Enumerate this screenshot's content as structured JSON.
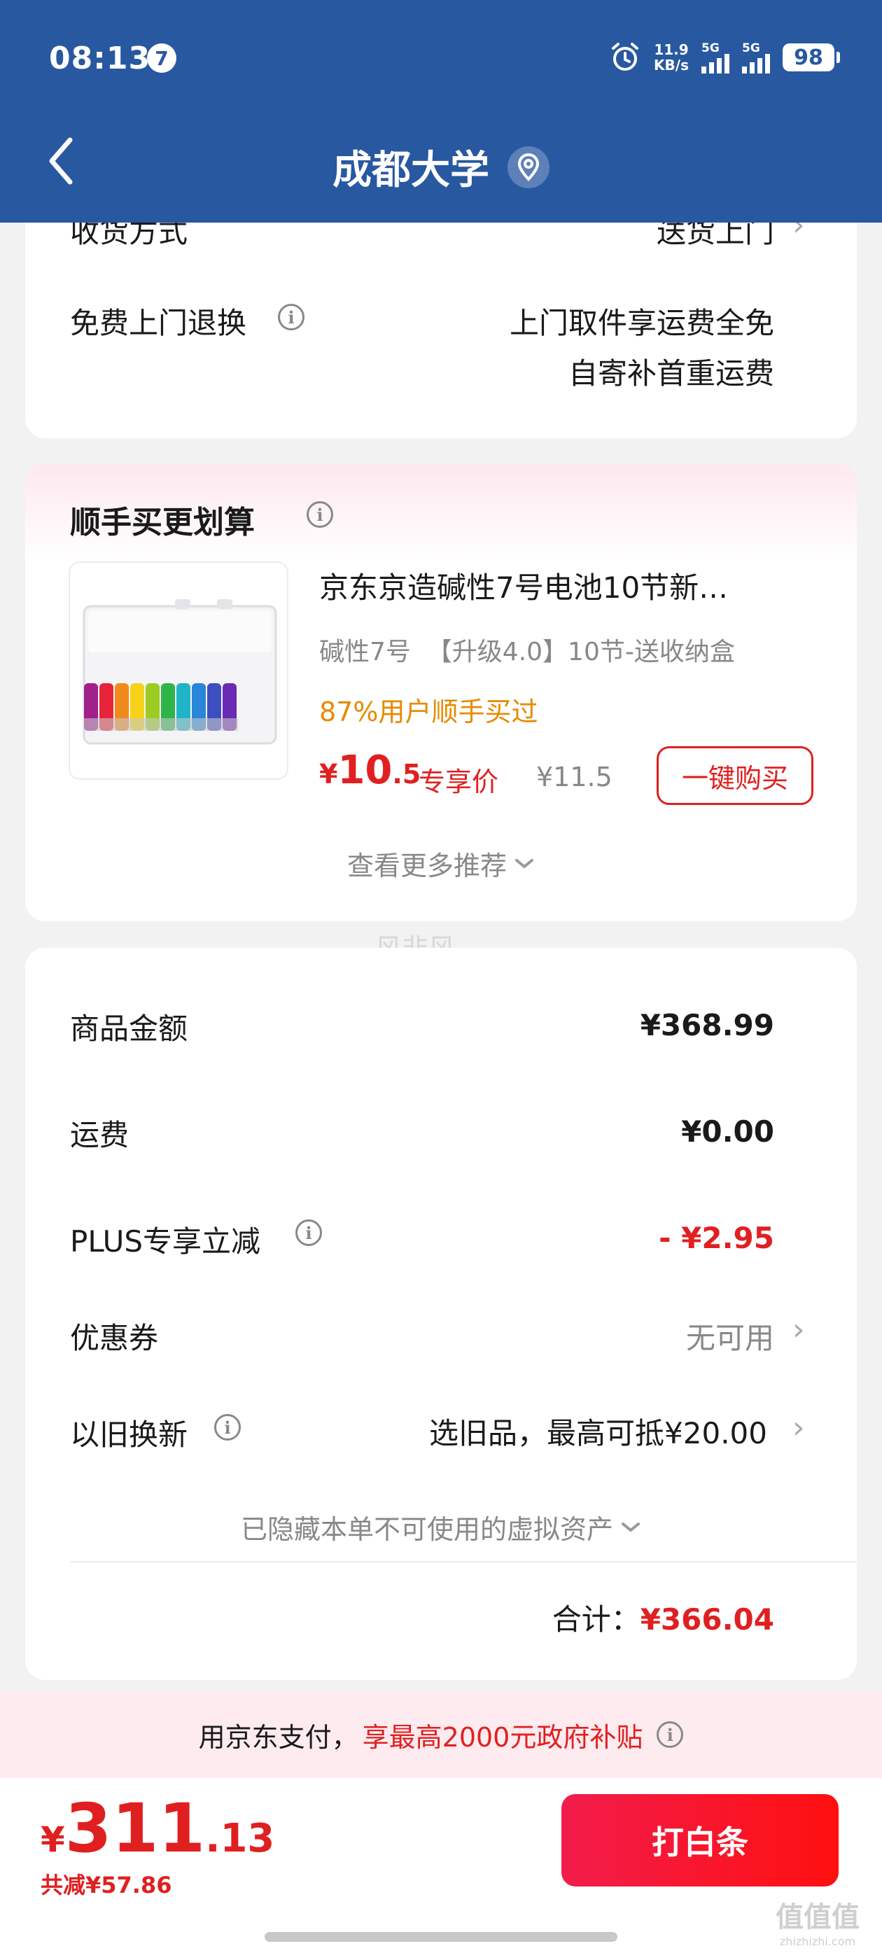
{
  "status_bar": {
    "time": "08:13",
    "notification_count": "7",
    "net_speed_value": "11.9",
    "net_speed_unit": "KB/s",
    "signal1_label": "5G",
    "signal2_label": "5G",
    "battery": "98",
    "colors": {
      "header_bg": "#2858a0"
    }
  },
  "header": {
    "title": "成都大学",
    "back_icon": "chevron-left-icon",
    "location_icon": "location-pin-icon"
  },
  "delivery_card": {
    "shipping_label": "收货方式",
    "shipping_value": "送货上门",
    "return_label": "免费上门退换",
    "return_value_line1": "上门取件享运费全免",
    "return_value_line2": "自寄补首重运费"
  },
  "cross_sell": {
    "title": "顺手买更划算",
    "product_name": "京东京造碱性7号电池10节新…",
    "product_spec": "碱性7号  【升级4.0】10节-送收纳盒",
    "buy_rate": "87%用户顺手买过",
    "price_symbol": "¥",
    "price_int": "10",
    "price_dec": ".5",
    "price_tag": "专享价",
    "original_price": "¥11.5",
    "buy_button": "一键购买",
    "more_link": "查看更多推荐"
  },
  "summary_card": {
    "items_label": "商品金额",
    "items_value": "¥368.99",
    "shipping_fee_label": "运费",
    "shipping_fee_value": "¥0.00",
    "plus_label": "PLUS专享立减",
    "plus_value": "- ¥2.95",
    "coupon_label": "优惠券",
    "coupon_value": "无可用",
    "trade_in_label": "以旧换新",
    "trade_in_value": "选旧品，最高可抵¥20.00",
    "hidden_assets": "已隐藏本单不可使用的虚拟资产",
    "total_label": "合计：",
    "total_value": "¥366.04"
  },
  "subsidy_bar": {
    "text_plain": "用京东支付，",
    "text_highlight": "享最高2000元政府补贴"
  },
  "bottom_bar": {
    "price_symbol": "¥",
    "price_int": "311",
    "price_dec": ".13",
    "discount": "共减¥57.86",
    "pay_button": "打白条"
  },
  "watermarks": {
    "center": "风非风",
    "corner": "值值值",
    "corner_url": "zhizhizhi.com"
  },
  "accent_colors": {
    "red": "#e02020",
    "orange": "#e68a00",
    "pink_bg": "#fdebef"
  }
}
